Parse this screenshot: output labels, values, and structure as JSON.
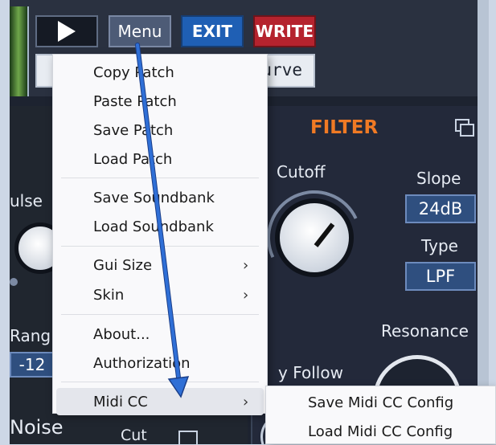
{
  "toolbar": {
    "menu_label": "Menu",
    "exit_label": "EXIT",
    "write_label": "WRITE",
    "curve_text": "urve"
  },
  "filter": {
    "title": "FILTER",
    "cutoff_label": "Cutoff",
    "slope_label": "Slope",
    "slope_value": "24dB",
    "type_label": "Type",
    "type_value": "LPF",
    "resonance_label": "Resonance",
    "keyfollow_label": "y Follow"
  },
  "left": {
    "pulse_label": "ulse",
    "range_label": "Rang",
    "range_value": "-12",
    "noise_label": "Noise",
    "cut_label": "Cut"
  },
  "menu": {
    "items": [
      {
        "label": "Copy Patch"
      },
      {
        "label": "Paste Patch"
      },
      {
        "label": "Save Patch"
      },
      {
        "label": "Load Patch"
      },
      {
        "label": "Save Soundbank"
      },
      {
        "label": "Load Soundbank"
      },
      {
        "label": "Gui Size",
        "chevron": "›"
      },
      {
        "label": "Skin",
        "chevron": "›"
      },
      {
        "label": "About..."
      },
      {
        "label": "Authorization"
      },
      {
        "label": "Midi CC",
        "chevron": "›"
      }
    ]
  },
  "submenu": {
    "items": [
      {
        "label": "Save Midi CC Config"
      },
      {
        "label": "Load Midi CC Config"
      }
    ]
  },
  "colors": {
    "filter_accent": "#f07a24",
    "exit_blue": "#1f5fb4",
    "write_red": "#b5232e",
    "annotation_arrow": "#2f6fd6"
  }
}
